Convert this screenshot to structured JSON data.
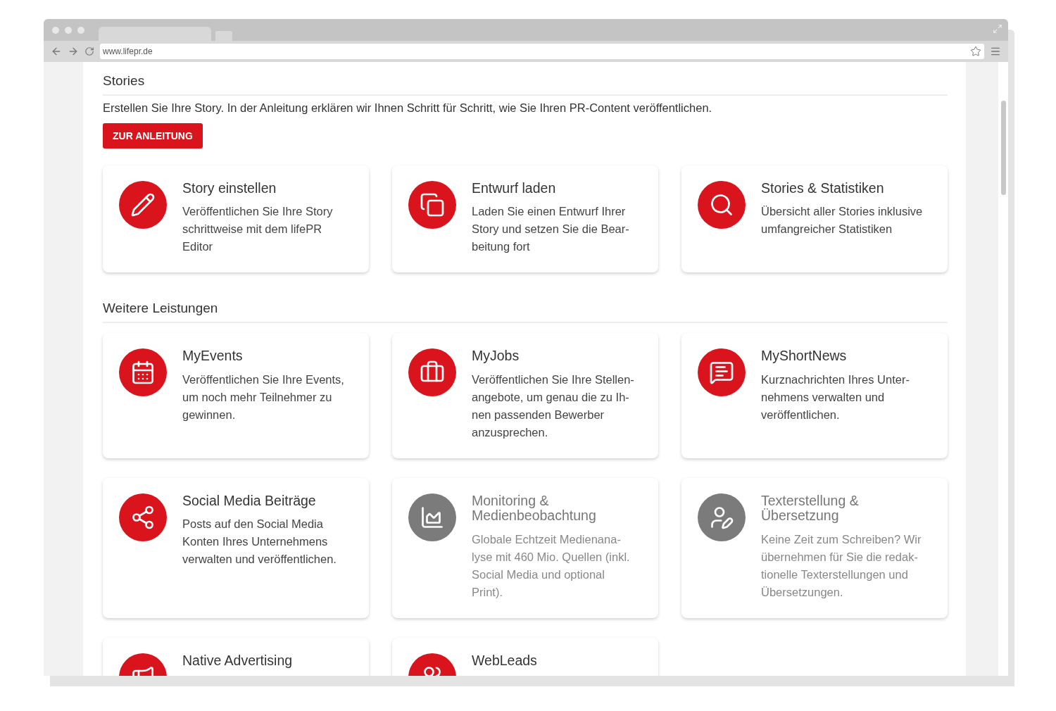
{
  "browser": {
    "url": "www.lifepr.de"
  },
  "stories": {
    "heading": "Stories",
    "intro": "Erstellen Sie Ihre Story. In der Anleitung erklären wir Ihnen Schritt für Schritt, wie Sie Ihren PR-Content veröffentlichen.",
    "button": "ZUR ANLEITUNG",
    "cards": [
      {
        "title": "Story einstellen",
        "description": "Veröffentlichen Sie Ihre Story\nschrittweise mit dem lifePR\nEditor",
        "disabled": false
      },
      {
        "title": "Entwurf laden",
        "description": "Laden Sie einen Entwurf Ihrer\nStory und setzen Sie die Bear-\nbeitung fort",
        "disabled": false
      },
      {
        "title": "Stories & Statistiken",
        "description": "Übersicht aller Stories inklusive\numfangreicher Statistiken",
        "disabled": false
      }
    ]
  },
  "services": {
    "heading": "Weitere Leistungen",
    "cards": [
      {
        "title": "MyEvents",
        "description": "Veröffentlichen Sie Ihre Events,\num noch mehr Teilnehmer zu\ngewinnen.",
        "disabled": false
      },
      {
        "title": "MyJobs",
        "description": "Veröffentlichen Sie Ihre Stellen-\nangebote, um genau die zu Ih-\nnen passenden Bewerber\nanzusprechen.",
        "disabled": false
      },
      {
        "title": "MyShortNews",
        "description": "Kurznachrichten Ihres Unter-\nnehmens verwalten und\nveröffentlichen.",
        "disabled": false
      },
      {
        "title": "Social Media Beiträge",
        "description": "Posts auf den Social Media\nKonten Ihres Unternehmens\nverwalten und veröffentlichen.",
        "disabled": false
      },
      {
        "title": "Monitoring &\nMedienbeobachtung",
        "description": "Globale Echtzeit Medienana-\nlyse mit 460 Mio. Quellen (inkl.\nSocial Media und optional\nPrint).",
        "disabled": true
      },
      {
        "title": "Texterstellung &\nÜbersetzung",
        "description": "Keine Zeit zum Schreiben? Wir\nübernehmen für Sie die redak-\ntionelle Texterstellungen und\nÜbersetzungen.",
        "disabled": true
      },
      {
        "title": "Native Advertising",
        "disabled": false
      },
      {
        "title": "WebLeads",
        "disabled": false
      }
    ]
  }
}
